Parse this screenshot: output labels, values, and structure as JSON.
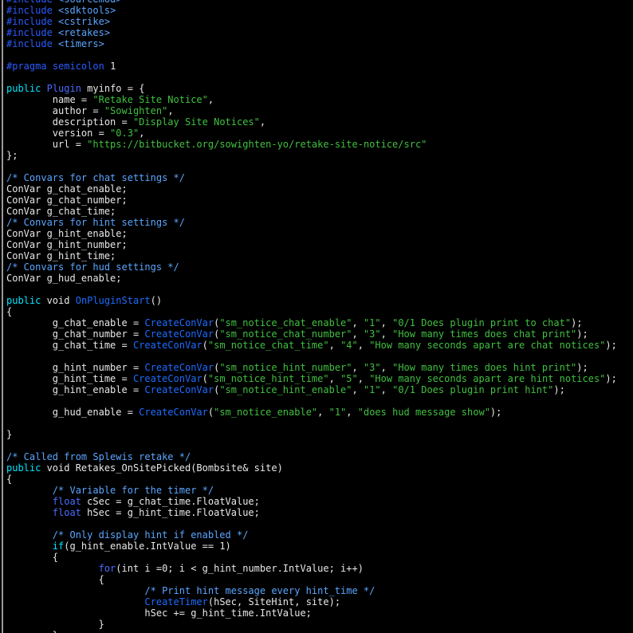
{
  "colors": {
    "background": "#000000",
    "text": "#e8e8e8",
    "comment": "#5aa6ff",
    "string": "#40c040",
    "keyword": "#00e5ff",
    "type": "#4a6cff",
    "function": "#1e6cff",
    "preprocessor": "#2a5cff"
  },
  "lines": [
    [
      {
        "k": "pp",
        "t": "#include"
      },
      {
        "k": "plain",
        "t": " "
      },
      {
        "k": "cmt",
        "t": "<sourcemod>"
      }
    ],
    [
      {
        "k": "pp",
        "t": "#include"
      },
      {
        "k": "plain",
        "t": " "
      },
      {
        "k": "cmt",
        "t": "<sdktools>"
      }
    ],
    [
      {
        "k": "pp",
        "t": "#include"
      },
      {
        "k": "plain",
        "t": " "
      },
      {
        "k": "cmt",
        "t": "<cstrike>"
      }
    ],
    [
      {
        "k": "pp",
        "t": "#include"
      },
      {
        "k": "plain",
        "t": " "
      },
      {
        "k": "cmt",
        "t": "<retakes>"
      }
    ],
    [
      {
        "k": "pp",
        "t": "#include"
      },
      {
        "k": "plain",
        "t": " "
      },
      {
        "k": "cmt",
        "t": "<timers>"
      }
    ],
    [],
    [
      {
        "k": "pp",
        "t": "#pragma"
      },
      {
        "k": "plain",
        "t": " "
      },
      {
        "k": "pp",
        "t": "semicolon"
      },
      {
        "k": "plain",
        "t": " 1"
      }
    ],
    [],
    [
      {
        "k": "kw",
        "t": "public"
      },
      {
        "k": "plain",
        "t": " "
      },
      {
        "k": "typ",
        "t": "Plugin"
      },
      {
        "k": "plain",
        "t": " myinfo = {"
      }
    ],
    [
      {
        "k": "plain",
        "t": "        name = "
      },
      {
        "k": "str",
        "t": "\"Retake Site Notice\""
      },
      {
        "k": "plain",
        "t": ","
      }
    ],
    [
      {
        "k": "plain",
        "t": "        author = "
      },
      {
        "k": "str",
        "t": "\"Sowighten\""
      },
      {
        "k": "plain",
        "t": ","
      }
    ],
    [
      {
        "k": "plain",
        "t": "        description = "
      },
      {
        "k": "str",
        "t": "\"Display Site Notices\""
      },
      {
        "k": "plain",
        "t": ","
      }
    ],
    [
      {
        "k": "plain",
        "t": "        version = "
      },
      {
        "k": "str",
        "t": "\"0.3\""
      },
      {
        "k": "plain",
        "t": ","
      }
    ],
    [
      {
        "k": "plain",
        "t": "        url = "
      },
      {
        "k": "str",
        "t": "\"https://bitbucket.org/sowighten-yo/retake-site-notice/src\""
      }
    ],
    [
      {
        "k": "plain",
        "t": "};"
      }
    ],
    [],
    [
      {
        "k": "cmt",
        "t": "/* Convars for chat settings */"
      }
    ],
    [
      {
        "k": "plain",
        "t": "ConVar g_chat_enable;"
      }
    ],
    [
      {
        "k": "plain",
        "t": "ConVar g_chat_number;"
      }
    ],
    [
      {
        "k": "plain",
        "t": "ConVar g_chat_time;"
      }
    ],
    [
      {
        "k": "cmt",
        "t": "/* Convars for hint settings */"
      }
    ],
    [
      {
        "k": "plain",
        "t": "ConVar g_hint_enable;"
      }
    ],
    [
      {
        "k": "plain",
        "t": "ConVar g_hint_number;"
      }
    ],
    [
      {
        "k": "plain",
        "t": "ConVar g_hint_time;"
      }
    ],
    [
      {
        "k": "cmt",
        "t": "/* Convars for hud settings */"
      }
    ],
    [
      {
        "k": "plain",
        "t": "ConVar g_hud_enable;"
      }
    ],
    [],
    [
      {
        "k": "kw",
        "t": "public"
      },
      {
        "k": "plain",
        "t": " void "
      },
      {
        "k": "fn",
        "t": "OnPluginStart"
      },
      {
        "k": "plain",
        "t": "()"
      }
    ],
    [
      {
        "k": "plain",
        "t": "{"
      }
    ],
    [
      {
        "k": "plain",
        "t": "        g_chat_enable = "
      },
      {
        "k": "fn",
        "t": "CreateConVar"
      },
      {
        "k": "plain",
        "t": "("
      },
      {
        "k": "str",
        "t": "\"sm_notice_chat_enable\""
      },
      {
        "k": "plain",
        "t": ", "
      },
      {
        "k": "str",
        "t": "\"1\""
      },
      {
        "k": "plain",
        "t": ", "
      },
      {
        "k": "str",
        "t": "\"0/1 Does plugin print to chat\""
      },
      {
        "k": "plain",
        "t": ");"
      }
    ],
    [
      {
        "k": "plain",
        "t": "        g_chat_number = "
      },
      {
        "k": "fn",
        "t": "CreateConVar"
      },
      {
        "k": "plain",
        "t": "("
      },
      {
        "k": "str",
        "t": "\"sm_notice_chat_number\""
      },
      {
        "k": "plain",
        "t": ", "
      },
      {
        "k": "str",
        "t": "\"3\""
      },
      {
        "k": "plain",
        "t": ", "
      },
      {
        "k": "str",
        "t": "\"How many times does chat print\""
      },
      {
        "k": "plain",
        "t": ");"
      }
    ],
    [
      {
        "k": "plain",
        "t": "        g_chat_time = "
      },
      {
        "k": "fn",
        "t": "CreateConVar"
      },
      {
        "k": "plain",
        "t": "("
      },
      {
        "k": "str",
        "t": "\"sm_notice_chat_time\""
      },
      {
        "k": "plain",
        "t": ", "
      },
      {
        "k": "str",
        "t": "\"4\""
      },
      {
        "k": "plain",
        "t": ", "
      },
      {
        "k": "str",
        "t": "\"How many seconds apart are chat notices\""
      },
      {
        "k": "plain",
        "t": ");"
      }
    ],
    [],
    [
      {
        "k": "plain",
        "t": "        g_hint_number = "
      },
      {
        "k": "fn",
        "t": "CreateConVar"
      },
      {
        "k": "plain",
        "t": "("
      },
      {
        "k": "str",
        "t": "\"sm_notice_hint_number\""
      },
      {
        "k": "plain",
        "t": ", "
      },
      {
        "k": "str",
        "t": "\"3\""
      },
      {
        "k": "plain",
        "t": ", "
      },
      {
        "k": "str",
        "t": "\"How many times does hint print\""
      },
      {
        "k": "plain",
        "t": ");"
      }
    ],
    [
      {
        "k": "plain",
        "t": "        g_hint_time = "
      },
      {
        "k": "fn",
        "t": "CreateConVar"
      },
      {
        "k": "plain",
        "t": "("
      },
      {
        "k": "str",
        "t": "\"sm_notice_hint_time\""
      },
      {
        "k": "plain",
        "t": ", "
      },
      {
        "k": "str",
        "t": "\"5\""
      },
      {
        "k": "plain",
        "t": ", "
      },
      {
        "k": "str",
        "t": "\"How many seconds apart are hint notices\""
      },
      {
        "k": "plain",
        "t": ");"
      }
    ],
    [
      {
        "k": "plain",
        "t": "        g_hint_enable = "
      },
      {
        "k": "fn",
        "t": "CreateConVar"
      },
      {
        "k": "plain",
        "t": "("
      },
      {
        "k": "str",
        "t": "\"sm_notice_hint_enable\""
      },
      {
        "k": "plain",
        "t": ", "
      },
      {
        "k": "str",
        "t": "\"1\""
      },
      {
        "k": "plain",
        "t": ", "
      },
      {
        "k": "str",
        "t": "\"0/1 Does plugin print hint\""
      },
      {
        "k": "plain",
        "t": ");"
      }
    ],
    [],
    [
      {
        "k": "plain",
        "t": "        g_hud_enable = "
      },
      {
        "k": "fn",
        "t": "CreateConVar"
      },
      {
        "k": "plain",
        "t": "("
      },
      {
        "k": "str",
        "t": "\"sm_notice_enable\""
      },
      {
        "k": "plain",
        "t": ", "
      },
      {
        "k": "str",
        "t": "\"1\""
      },
      {
        "k": "plain",
        "t": ", "
      },
      {
        "k": "str",
        "t": "\"does hud message show\""
      },
      {
        "k": "plain",
        "t": ");"
      }
    ],
    [],
    [
      {
        "k": "plain",
        "t": "}"
      }
    ],
    [],
    [
      {
        "k": "cmt",
        "t": "/* Called from Splewis retake */"
      }
    ],
    [
      {
        "k": "kw",
        "t": "public"
      },
      {
        "k": "plain",
        "t": " void Retakes_OnSitePicked(Bombsite& site)"
      }
    ],
    [
      {
        "k": "plain",
        "t": "{"
      }
    ],
    [
      {
        "k": "plain",
        "t": "        "
      },
      {
        "k": "cmt",
        "t": "/* Variable for the timer */"
      }
    ],
    [
      {
        "k": "plain",
        "t": "        "
      },
      {
        "k": "typ",
        "t": "float"
      },
      {
        "k": "plain",
        "t": " cSec = g_chat_time.FloatValue;"
      }
    ],
    [
      {
        "k": "plain",
        "t": "        "
      },
      {
        "k": "typ",
        "t": "float"
      },
      {
        "k": "plain",
        "t": " hSec = g_hint_time.FloatValue;"
      }
    ],
    [],
    [
      {
        "k": "plain",
        "t": "        "
      },
      {
        "k": "cmt",
        "t": "/* Only display hint if enabled */"
      }
    ],
    [
      {
        "k": "plain",
        "t": "        "
      },
      {
        "k": "kw",
        "t": "if"
      },
      {
        "k": "plain",
        "t": "(g_hint_enable.IntValue == 1)"
      }
    ],
    [
      {
        "k": "plain",
        "t": "        {"
      }
    ],
    [
      {
        "k": "plain",
        "t": "                "
      },
      {
        "k": "typ",
        "t": "for"
      },
      {
        "k": "plain",
        "t": "(int i =0; i < g_hint_number.IntValue; i++)"
      }
    ],
    [
      {
        "k": "plain",
        "t": "                {"
      }
    ],
    [
      {
        "k": "plain",
        "t": "                        "
      },
      {
        "k": "cmt",
        "t": "/* Print hint message every hint_time */"
      }
    ],
    [
      {
        "k": "plain",
        "t": "                        "
      },
      {
        "k": "fn",
        "t": "CreateTimer"
      },
      {
        "k": "plain",
        "t": "(hSec, SiteHint, site);"
      }
    ],
    [
      {
        "k": "plain",
        "t": "                        hSec += g_hint_time.IntValue;"
      }
    ],
    [
      {
        "k": "plain",
        "t": "                }"
      }
    ],
    [
      {
        "k": "plain",
        "t": "        }"
      }
    ]
  ]
}
